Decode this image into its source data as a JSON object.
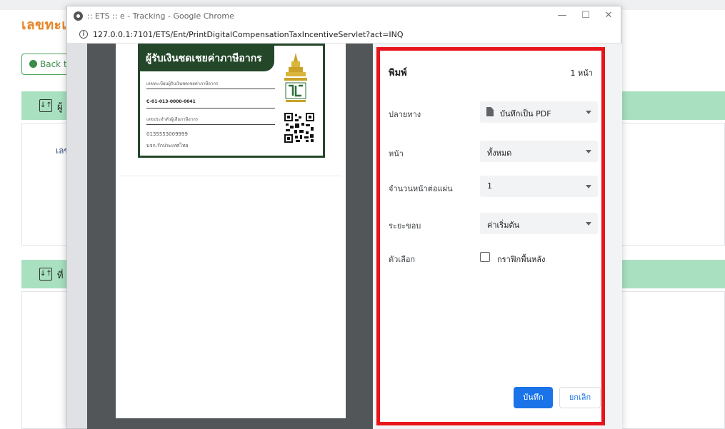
{
  "background": {
    "title": "เลขทะเบี",
    "back_label": "Back t",
    "section1_label": "ผู้",
    "section2_label": "ที่",
    "field_label": "เลข"
  },
  "window": {
    "title": ":: ETS :: e - Tracking - Google Chrome",
    "minimize": "—",
    "maximize": "☐",
    "close": "✕",
    "url": "127.0.0.1:7101/ETS/Ent/PrintDigitalCompensationTaxIncentiveServlet?act=INQ"
  },
  "preview": {
    "card": {
      "heading": "ผู้รับเงินชดเชยค่าภาษีอากร",
      "reg_label": "เลขทะเบียนผู้รับเงินชดเชยค่าภาษีอากร",
      "reg_value": "C-01-013-0000-0041",
      "tax_label": "เลขประจำตัวผู้เสียภาษีอากร",
      "tax_value": "0135553009999",
      "company": "บจก.รักประเทศไทย"
    }
  },
  "print_dialog": {
    "title": "พิมพ์",
    "page_count": "1 หน้า",
    "destination_label": "ปลายทาง",
    "destination_value": "บันทึกเป็น PDF",
    "pages_label": "หน้า",
    "pages_value": "ทั้งหมด",
    "pages_per_sheet_label": "จำนวนหน้าต่อแผ่น",
    "pages_per_sheet_value": "1",
    "margins_label": "ระยะขอบ",
    "margins_value": "ค่าเริ่มต้น",
    "options_label": "ตัวเลือก",
    "background_graphics_label": "กราฟิกพื้นหลัง",
    "background_graphics_checked": false,
    "save_label": "บันทึก",
    "cancel_label": "ยกเลิก"
  },
  "colors": {
    "highlight_border": "#e8141b",
    "primary_button": "#1a73e8",
    "card_green": "#24472a",
    "band_green": "#a8e0c0",
    "title_orange": "#e8862a"
  }
}
